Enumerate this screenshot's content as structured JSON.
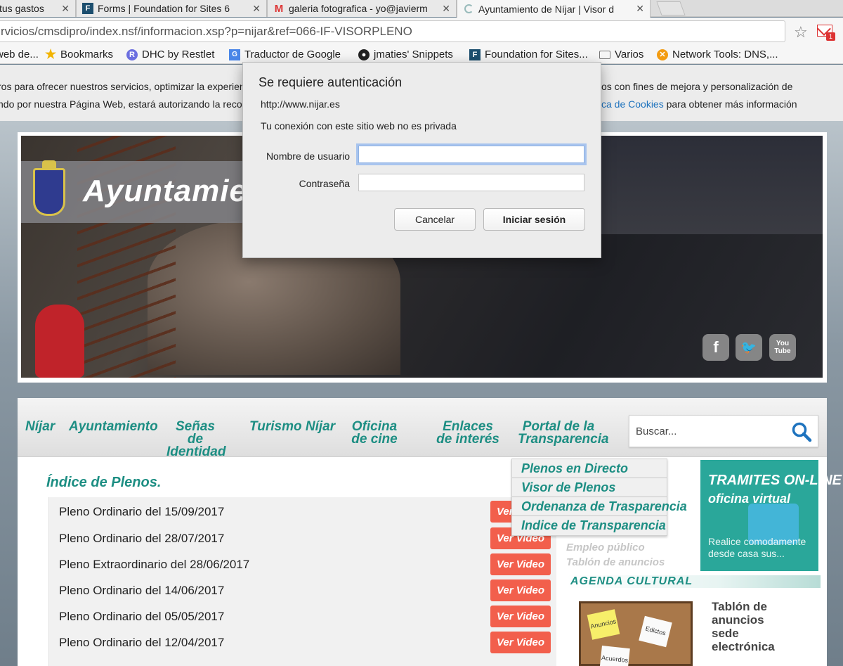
{
  "browser": {
    "tabs": [
      {
        "title": "tus gastos",
        "icon": "google-icon",
        "active": false
      },
      {
        "title": "Forms | Foundation for Sites 6",
        "icon": "foundation-icon",
        "active": false
      },
      {
        "title": "galeria fotografica - yo@javierm",
        "icon": "gmail-icon",
        "active": false
      },
      {
        "title": "Ayuntamiento de Níjar | Visor d",
        "icon": "loading-icon",
        "active": true
      }
    ],
    "url": "rvicios/cmsdipro/index.nsf/informacion.xsp?p=nijar&ref=066-IF-VISORPLENO",
    "gmail_badge": "1",
    "bookmarks": [
      {
        "label": "web de...",
        "icon": "none"
      },
      {
        "label": "Bookmarks",
        "icon": "star-icon"
      },
      {
        "label": "DHC by Restlet",
        "icon": "restlet-icon"
      },
      {
        "label": "Traductor de Google",
        "icon": "google-translate-icon"
      },
      {
        "label": "jmaties' Snippets",
        "icon": "github-icon"
      },
      {
        "label": "Foundation for Sites...",
        "icon": "foundation-icon"
      },
      {
        "label": "Varios",
        "icon": "folder-icon"
      },
      {
        "label": "Network Tools: DNS,...",
        "icon": "network-tools-icon"
      }
    ]
  },
  "cookie_bar": {
    "line1_left": "ros para ofrecer nuestros servicios, optimizar la experien",
    "line1_right": "os con fines de mejora y personalización de",
    "line2_left": "ndo por nuestra Página Web, estará autorizando la recop",
    "line2_link": "ca de Cookies",
    "line2_right": " para obtener más información"
  },
  "header": {
    "logo_text": "Ayuntamient",
    "social": [
      "f",
      "t",
      "You Tube"
    ]
  },
  "nav": {
    "items": [
      "Níjar",
      "Ayuntamiento",
      "Señas de Identidad",
      "Turismo Níjar",
      "Oficina de cine",
      "Enlaces de interés",
      "Portal de la Transparencia"
    ],
    "search_placeholder": "Buscar..."
  },
  "dropdown": {
    "items": [
      "Plenos en Directo",
      "Visor de Plenos",
      "Ordenanza de Trasparencia",
      "Indice de Transparencia"
    ]
  },
  "main": {
    "title": "Índice de Plenos.",
    "plenos": [
      {
        "label": "Pleno Ordinario del 15/09/2017",
        "button": "Ver Video"
      },
      {
        "label": "Pleno Ordinario del 28/07/2017",
        "button": "Ver Video"
      },
      {
        "label": "Pleno Extraordinario del 28/06/2017",
        "button": "Ver Video"
      },
      {
        "label": "Pleno Ordinario del 14/06/2017",
        "button": "Ver Video"
      },
      {
        "label": "Pleno Ordinario del 05/05/2017",
        "button": "Ver Video"
      },
      {
        "label": "Pleno Ordinario del 12/04/2017",
        "button": "Ver Video"
      }
    ]
  },
  "sidebar": {
    "faded_links": [
      "Empleo público",
      "Tablón de anuncios"
    ],
    "tramites_title": "TRAMITES ON-LINE",
    "tramites_sub": "oficina virtual",
    "tramites_desc_1": "Realice comodamente",
    "tramites_desc_2": "desde casa sus...",
    "agenda": "AGENDA CULTURAL",
    "board_notes": [
      "Anuncios",
      "Edictos",
      "Acuerdos"
    ],
    "tablon_lines": [
      "Tablón de",
      "anuncios",
      "sede",
      "electrónica"
    ]
  },
  "auth_dialog": {
    "title": "Se requiere autenticación",
    "host": "http://www.nijar.es",
    "warning": "Tu conexión con este sitio web no es privada",
    "username_label": "Nombre de usuario",
    "password_label": "Contraseña",
    "username_value": "",
    "password_value": "",
    "cancel_label": "Cancelar",
    "login_label": "Iniciar sesión"
  }
}
